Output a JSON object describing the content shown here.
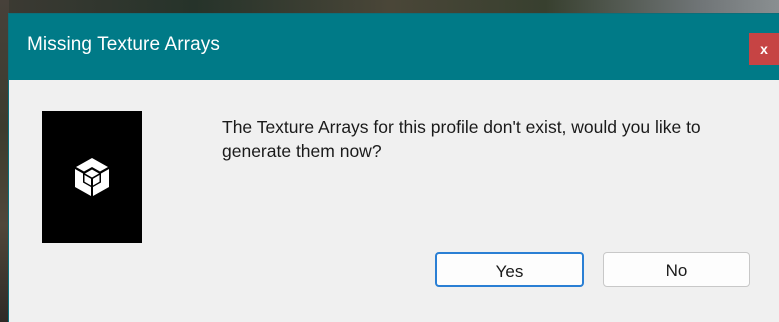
{
  "dialog": {
    "title": "Missing Texture Arrays",
    "close_label": "x",
    "message": "The Texture Arrays for this profile don't exist, would you like to generate them now?",
    "buttons": {
      "yes_label": "Yes",
      "no_label": "No"
    },
    "icon": "unity-logo-icon"
  },
  "colors": {
    "titlebar": "#007a87",
    "close_button": "#c64444",
    "body": "#f0f0f0",
    "default_button_border": "#2a7fd4"
  }
}
